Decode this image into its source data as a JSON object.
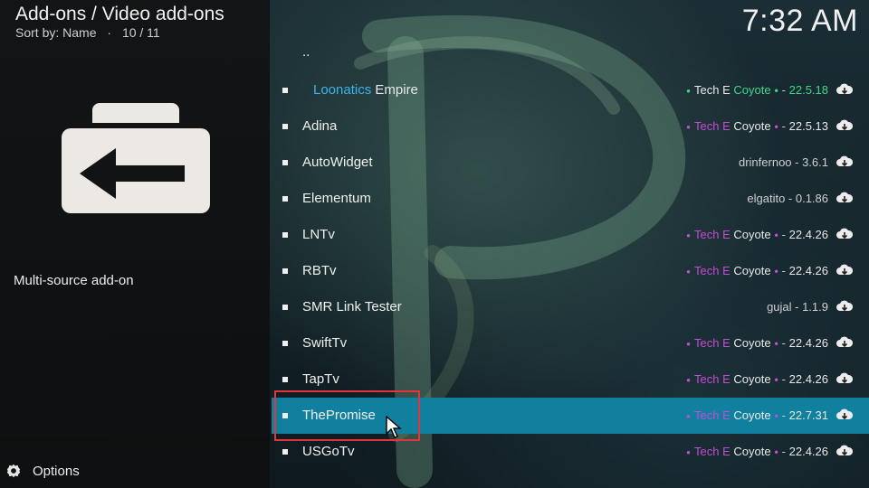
{
  "header": {
    "title": "Add-ons / Video add-ons",
    "sort": "Sort by: Name",
    "separator": "·",
    "count": "10 / 11"
  },
  "clock": "7:32 AM",
  "description": "Multi-source add-on",
  "options_label": "Options",
  "parent_item": "..",
  "items": [
    {
      "name": "Loonatics",
      "name2": "Empire",
      "author": [
        "Tech",
        "E",
        "Coyote"
      ],
      "version": "22.5.18",
      "style": "loonatics"
    },
    {
      "name": "Adina",
      "author": [
        "Tech",
        "E",
        "Coyote"
      ],
      "version": "22.5.13",
      "style": "tech"
    },
    {
      "name": "AutoWidget",
      "meta": "drinfernoo - 3.6.1",
      "style": "plain"
    },
    {
      "name": "Elementum",
      "meta": "elgatito - 0.1.86",
      "style": "plain"
    },
    {
      "name": "LNTv",
      "author": [
        "Tech",
        "E",
        "Coyote"
      ],
      "version": "22.4.26",
      "style": "tech"
    },
    {
      "name": "RBTv",
      "author": [
        "Tech",
        "E",
        "Coyote"
      ],
      "version": "22.4.26",
      "style": "tech"
    },
    {
      "name": "SMR Link Tester",
      "meta": "gujal - 1.1.9",
      "style": "plain"
    },
    {
      "name": "SwiftTv",
      "author": [
        "Tech",
        "E",
        "Coyote"
      ],
      "version": "22.4.26",
      "style": "tech"
    },
    {
      "name": "TapTv",
      "author": [
        "Tech",
        "E",
        "Coyote"
      ],
      "version": "22.4.26",
      "style": "tech"
    },
    {
      "name": "ThePromise",
      "author": [
        "Tech",
        "E",
        "Coyote"
      ],
      "version": "22.7.31",
      "style": "tech",
      "selected": true
    },
    {
      "name": "USGoTv",
      "author": [
        "Tech",
        "E",
        "Coyote"
      ],
      "version": "22.4.26",
      "style": "tech"
    }
  ],
  "colors": {
    "selection": "#11809f",
    "highlight_box": "#e2343b",
    "accent_pink": "#c64bd6",
    "accent_green": "#3ed88a",
    "accent_blue": "#3fb3ea"
  },
  "icons": {
    "folder": "folder-back-icon",
    "download": "cloud-download-icon",
    "options": "gear-icon"
  }
}
